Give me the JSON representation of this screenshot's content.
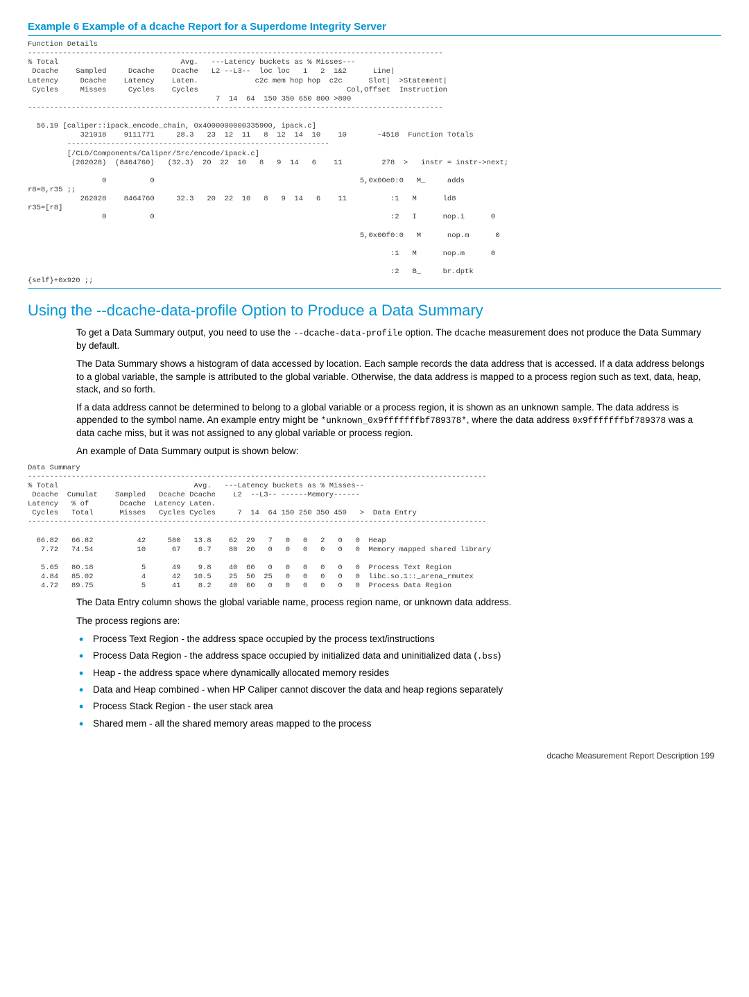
{
  "example6": {
    "title": "Example 6 Example of a dcache Report for a Superdome Integrity Server",
    "report": "Function Details\n-----------------------------------------------------------------------------------------------\n% Total                            Avg.   ---Latency buckets as % Misses---\n Dcache    Sampled     Dcache    Dcache   L2 --L3--  loc loc   1   2  1&2      Line|\nLatency     Dcache    Latency    Laten.             c2c mem hop hop  c2c      Slot|  >Statement|\n Cycles     Misses     Cycles    Cycles                                  Col,Offset  Instruction\n                                           7  14  64  150 350 650 800 >800\n-----------------------------------------------------------------------------------------------\n\n  56.19 [caliper::ipack_encode_chain, 0x4000000000335900, ipack.c]\n            321018    9111771     28.3   23  12  11   8  12  14  10    10       ~4518  Function Totals\n         ------------------------------------------------------------\n         [/CLO/Components/Caliper/Src/encode/ipack.c]\n          (262028)  (8464760)   (32.3)  20  22  10   8   9  14   6    11         278  >   instr = instr->next;\n\n                 0          0                                               5,0x00e0:0   M_     adds\nr8=8,r35 ;;\n            262028    8464760     32.3   20  22  10   8   9  14   6    11          :1   M      ld8\nr35=[r8]\n                 0          0                                                      :2   I      nop.i      0\n\n                                                                            5,0x00f0:0   M      nop.m      0\n\n                                                                                   :1   M      nop.m      0\n\n                                                                                   :2   B_     br.dptk\n{self}+0x920 ;;"
  },
  "section": {
    "heading": "Using the --dcache-data-profile Option to Produce a Data Summary",
    "p1a": "To get a Data Summary output, you need to use the ",
    "p1code": "--dcache-data-profile",
    "p1b": " option. The ",
    "p1code2": "dcache",
    "p1c": " measurement does not produce the Data Summary by default.",
    "p2": "The Data Summary shows a histogram of data accessed by location. Each sample records the data address that is accessed. If a data address belongs to a global variable, the sample is attributed to the global variable. Otherwise, the data address is mapped to a process region such as text, data, heap, stack, and so forth.",
    "p3a": "If a data address cannot be determined to belong to a global variable or a process region, it is shown as an unknown sample. The data address is appended to the symbol name. An example entry might be ",
    "p3code1": "*unknown_0x9fffffffbf789378*",
    "p3b": ", where the data address ",
    "p3code2": "0x9fffffffbf789378",
    "p3c": " was a data cache miss, but it was not assigned to any global variable or process region.",
    "p4": "An example of Data Summary output is shown below:",
    "summary_report": "Data Summary\n---------------------------------------------------------------------------------------------------------\n% Total                               Avg.   ---Latency buckets as % Misses--\n Dcache  Cumulat    Sampled   Dcache Dcache    L2  --L3-- ------Memory------\nLatency   % of       Dcache  Latency Laten.\n Cycles   Total      Misses   Cycles Cycles     7  14  64 150 250 350 450   >  Data Entry\n---------------------------------------------------------------------------------------------------------\n\n  66.82   66.82          42     580   13.8    62  29   7   0   0   2   0   0  Heap\n   7.72   74.54          10      67    6.7    80  20   0   0   0   0   0   0  Memory mapped shared library\n\n   5.65   80.18           5      49    9.8    40  60   0   0   0   0   0   0  Process Text Region\n   4.84   85.02           4      42   10.5    25  50  25   0   0   0   0   0  libc.so.1::_arena_rmutex\n   4.72   89.75           5      41    8.2    40  60   0   0   0   0   0   0  Process Data Region",
    "p5": "The Data Entry column shows the global variable name, process region name, or unknown data address.",
    "p6": "The process regions are:",
    "bullets": {
      "b1": "Process Text Region - the address space occupied by the process text/instructions",
      "b2a": "Process Data Region - the address space occupied by initialized data and uninitialized data (",
      "b2code": ".bss",
      "b2b": ")",
      "b3": "Heap - the address space where dynamically allocated memory resides",
      "b4": "Data and Heap combined - when HP Caliper cannot discover the data and heap regions separately",
      "b5": "Process Stack Region - the user stack area",
      "b6": "Shared mem - all the shared memory areas mapped to the process"
    }
  },
  "footer": "dcache Measurement Report Description   199"
}
